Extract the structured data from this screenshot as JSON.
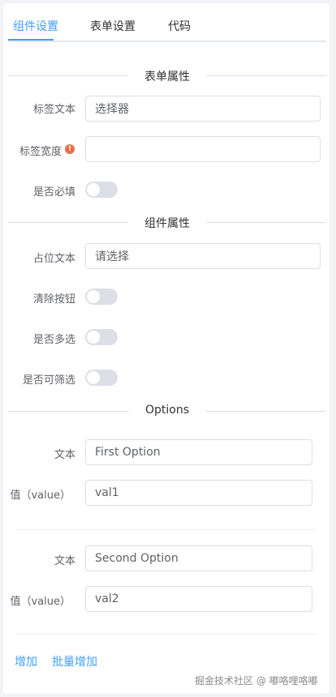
{
  "tabs": [
    {
      "label": "组件设置"
    },
    {
      "label": "表单设置"
    },
    {
      "label": "代码"
    }
  ],
  "form_section": {
    "title": "表单属性",
    "label_text": {
      "label": "标签文本",
      "value": "选择器"
    },
    "label_width": {
      "label": "标签宽度",
      "value": ""
    },
    "required": {
      "label": "是否必填",
      "on": false
    }
  },
  "component_section": {
    "title": "组件属性",
    "placeholder": {
      "label": "占位文本",
      "value": "请选择"
    },
    "clearable": {
      "label": "清除按钮",
      "on": false
    },
    "multiple": {
      "label": "是否多选",
      "on": false
    },
    "filterable": {
      "label": "是否可筛选",
      "on": false
    }
  },
  "options_section": {
    "title": "Options",
    "items": [
      {
        "text_label": "文本",
        "text": "First Option",
        "value_label": "值（value）",
        "value": "val1"
      },
      {
        "text_label": "文本",
        "text": "Second Option",
        "value_label": "值（value）",
        "value": "val2"
      }
    ]
  },
  "actions": {
    "add": "增加",
    "batch_add": "批量增加"
  },
  "watermark": "掘金技术社区 @ 嘟咯哩咯嘟",
  "colors": {
    "accent": "#409eff",
    "warning": "#e6704a",
    "switch_off": "#dcdfe6"
  }
}
